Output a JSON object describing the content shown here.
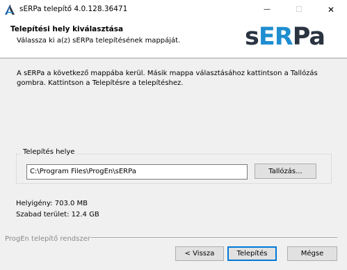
{
  "window": {
    "title": "sERPa telepítő 4.0.128.36471",
    "minimize_glyph": "—",
    "maximize_glyph": "☐",
    "close_glyph": "✕"
  },
  "header": {
    "title": "Telepítési hely kiválasztása",
    "subtitle": "Válassza ki a(z) sERPa telepítésének mappáját.",
    "logo": {
      "part1": "s",
      "part2": "ER",
      "part3": "Pa",
      "dark_color": "#2a3340",
      "blue_color": "#1f8ed0"
    }
  },
  "description": "A sERPa a következő mappába kerül. Másik mappa választásához kattintson a Tallózás gombra. Kattintson a Telepítésre a telepítéshez.",
  "install_location": {
    "group_label": "Telepítés helye",
    "path_value": "C:\\Program Files\\ProgEn\\sERPa",
    "browse_label": "Tallózás..."
  },
  "space": {
    "required": "Helyigény: 703.0 MB",
    "free": "Szabad terület: 12.4 GB"
  },
  "footer": {
    "brand": "ProgEn telepítő rendszer",
    "back_label": "< Vissza",
    "install_label": "Telepítés",
    "cancel_label": "Mégse"
  }
}
